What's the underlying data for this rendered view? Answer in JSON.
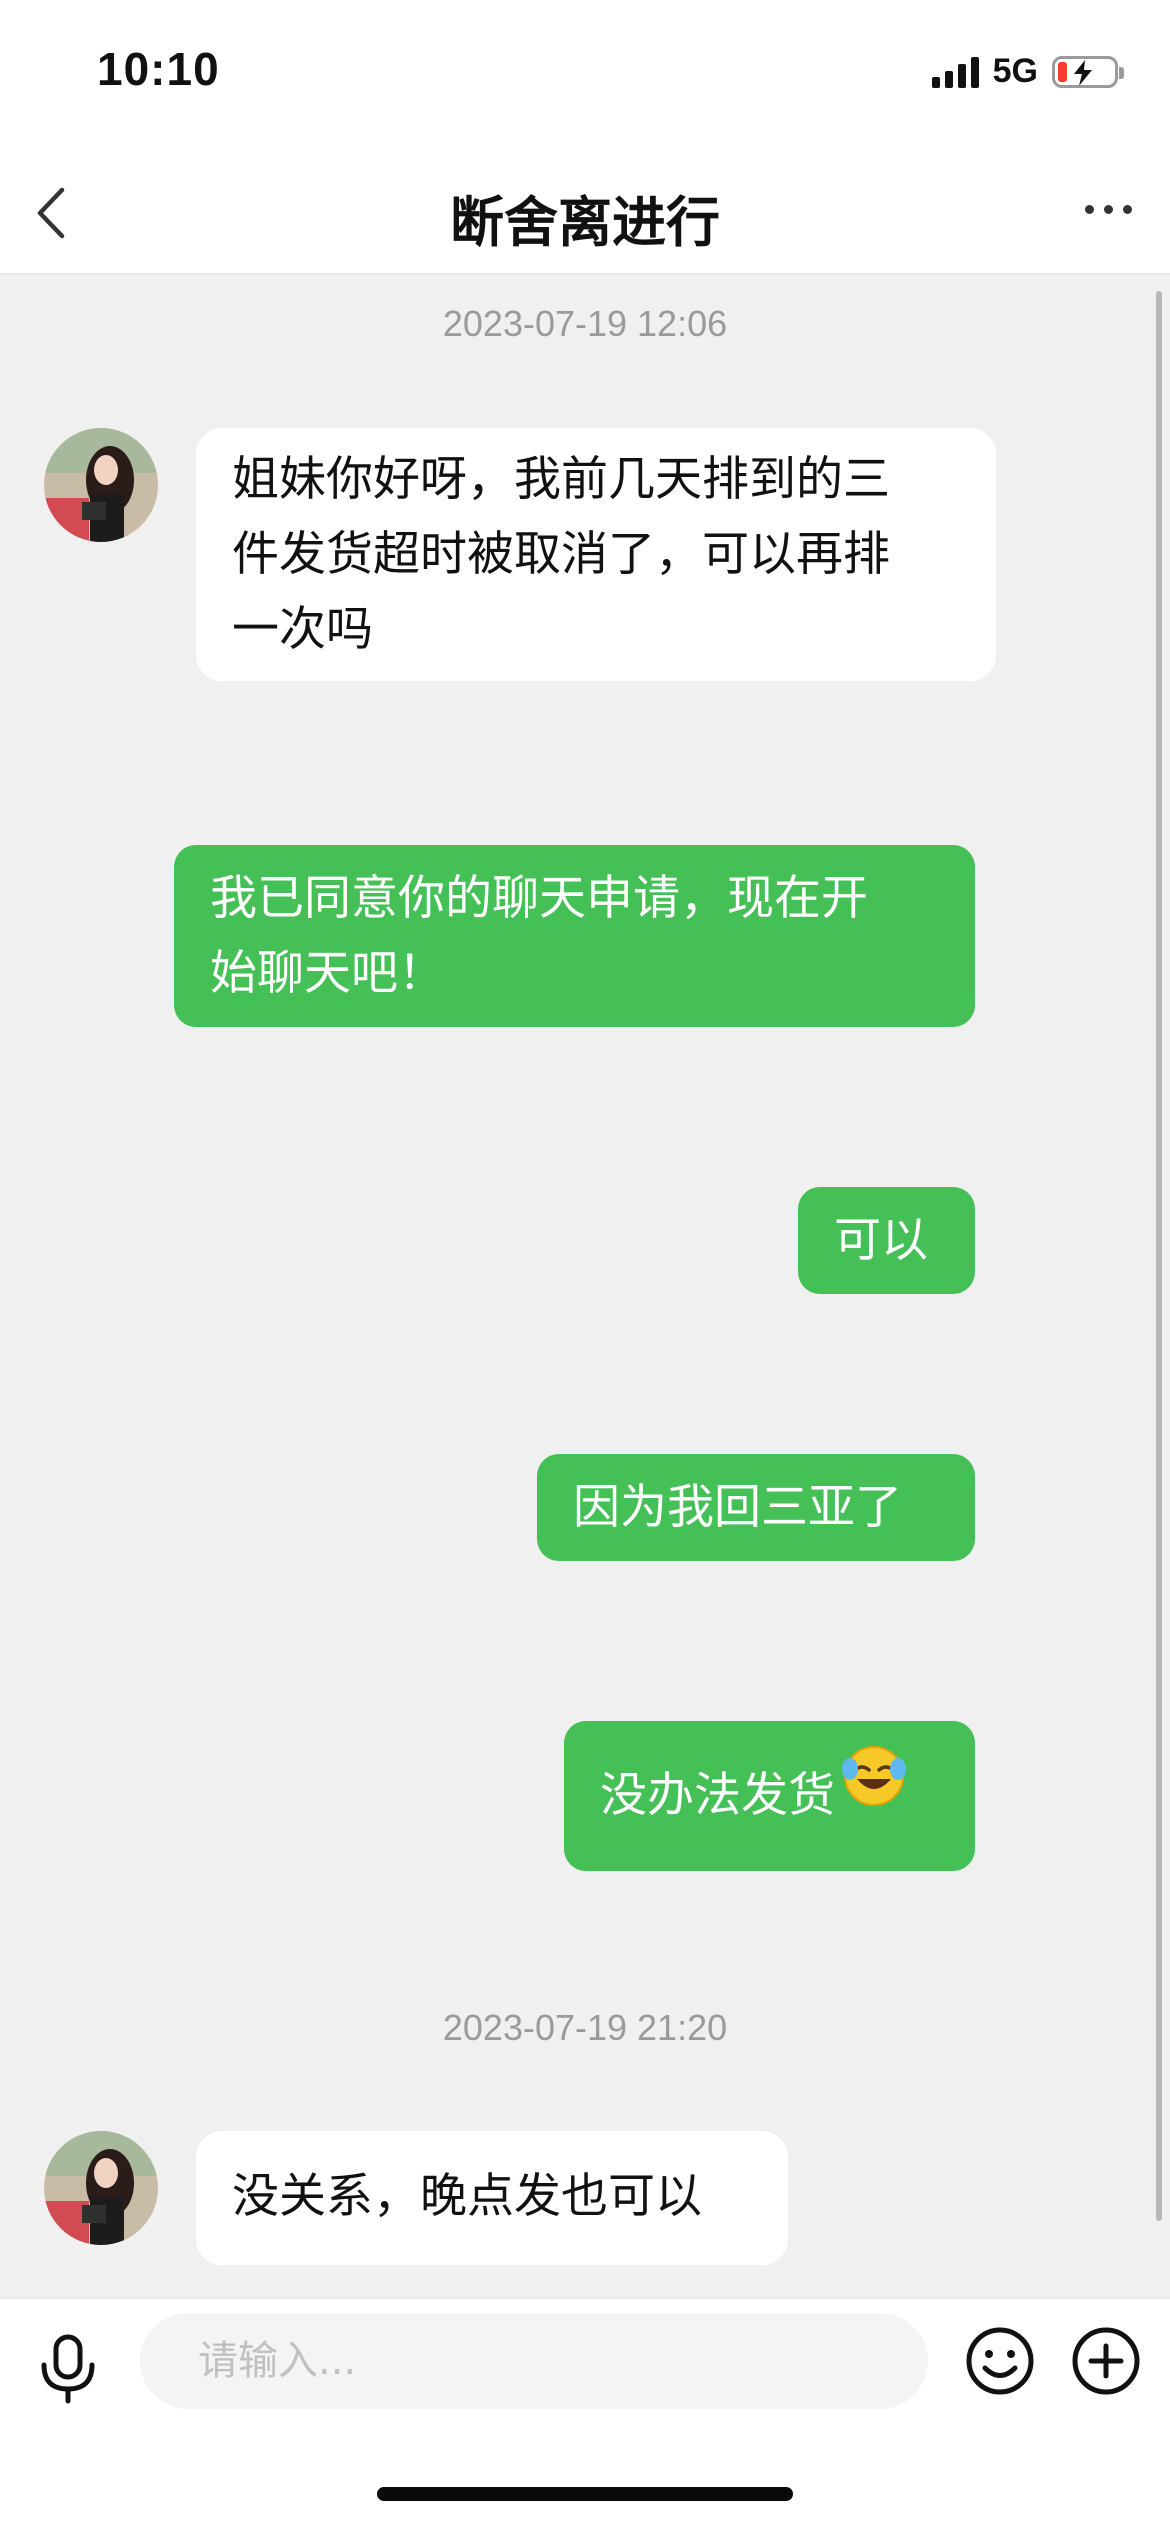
{
  "status_bar": {
    "time": "10:10",
    "network": "5G",
    "battery_charging": true
  },
  "header": {
    "title": "断舍离进行"
  },
  "messages": [
    {
      "type": "timestamp",
      "text": "2023-07-19 12:06"
    },
    {
      "type": "incoming",
      "lines": [
        "姐妹你好呀，我前几天排到的三",
        "件发货超时被取消了，可以再排",
        "一次吗"
      ]
    },
    {
      "type": "outgoing",
      "lines": [
        "我已同意你的聊天申请，现在开",
        "始聊天吧！"
      ]
    },
    {
      "type": "outgoing",
      "text": "可以"
    },
    {
      "type": "outgoing",
      "text": "因为我回三亚了"
    },
    {
      "type": "outgoing",
      "text": "没办法发货",
      "emoji": "laughing-crying-face"
    },
    {
      "type": "timestamp",
      "text": "2023-07-19 21:20"
    },
    {
      "type": "incoming",
      "text": "没关系，晚点发也可以"
    }
  ],
  "input": {
    "placeholder": "请输入..."
  },
  "colors": {
    "outgoing_bubble": "#45c057",
    "incoming_bubble": "#ffffff",
    "chat_background": "#f0f0f0"
  }
}
